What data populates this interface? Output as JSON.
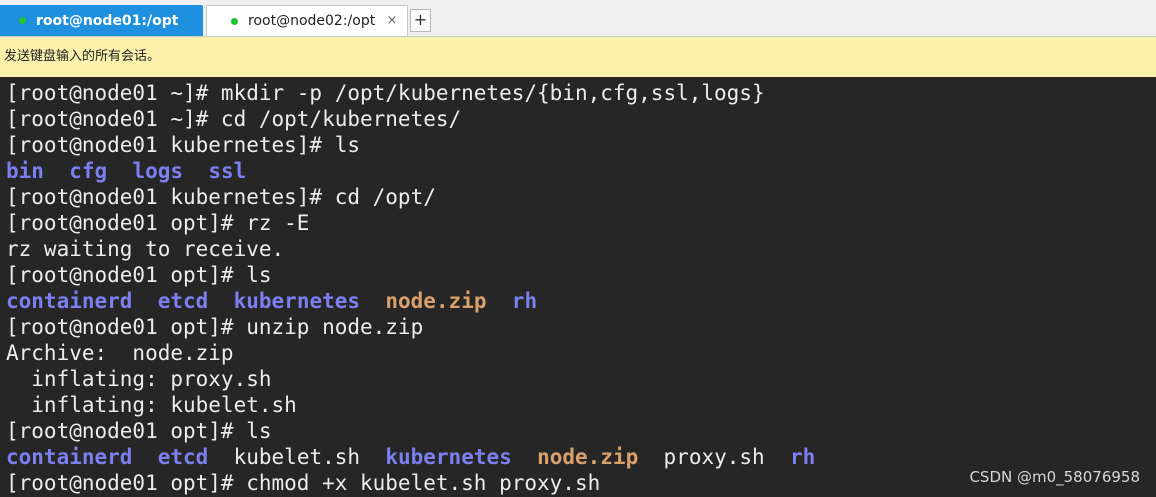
{
  "tabs": [
    {
      "label": "root@node01:/opt",
      "active": true
    },
    {
      "label": "root@node02:/opt",
      "active": false
    }
  ],
  "tab_close_glyph": "×",
  "add_tab_glyph": "+",
  "notice_text": "发送键盘输入的所有会话。",
  "colors": {
    "tab_active_bg": "#1f8fe0",
    "status_dot": "#1ec431",
    "notice_bg": "#fbf1ad",
    "terminal_bg": "#262626",
    "dir_color": "#7b7ff0",
    "zip_color": "#d9a06b"
  },
  "terminal": {
    "lines": [
      [
        {
          "t": "[root@node01 ~]# mkdir -p /opt/kubernetes/{bin,cfg,ssl,logs}",
          "k": "plain"
        }
      ],
      [
        {
          "t": "[root@node01 ~]# cd /opt/kubernetes/",
          "k": "plain"
        }
      ],
      [
        {
          "t": "[root@node01 kubernetes]# ls",
          "k": "plain"
        }
      ],
      [
        {
          "t": "bin",
          "k": "dir"
        },
        {
          "t": "  ",
          "k": "plain"
        },
        {
          "t": "cfg",
          "k": "dir"
        },
        {
          "t": "  ",
          "k": "plain"
        },
        {
          "t": "logs",
          "k": "dir"
        },
        {
          "t": "  ",
          "k": "plain"
        },
        {
          "t": "ssl",
          "k": "dir"
        }
      ],
      [
        {
          "t": "[root@node01 kubernetes]# cd /opt/",
          "k": "plain"
        }
      ],
      [
        {
          "t": "[root@node01 opt]# rz -E",
          "k": "plain"
        }
      ],
      [
        {
          "t": "rz waiting to receive.",
          "k": "plain"
        }
      ],
      [
        {
          "t": "[root@node01 opt]# ls",
          "k": "plain"
        }
      ],
      [
        {
          "t": "containerd",
          "k": "dir"
        },
        {
          "t": "  ",
          "k": "plain"
        },
        {
          "t": "etcd",
          "k": "dir"
        },
        {
          "t": "  ",
          "k": "plain"
        },
        {
          "t": "kubernetes",
          "k": "dir"
        },
        {
          "t": "  ",
          "k": "plain"
        },
        {
          "t": "node.zip",
          "k": "zip"
        },
        {
          "t": "  ",
          "k": "plain"
        },
        {
          "t": "rh",
          "k": "dir"
        }
      ],
      [
        {
          "t": "[root@node01 opt]# unzip node.zip",
          "k": "plain"
        }
      ],
      [
        {
          "t": "Archive:  node.zip",
          "k": "plain"
        }
      ],
      [
        {
          "t": "  inflating: proxy.sh",
          "k": "plain"
        }
      ],
      [
        {
          "t": "  inflating: kubelet.sh",
          "k": "plain"
        }
      ],
      [
        {
          "t": "[root@node01 opt]# ls",
          "k": "plain"
        }
      ],
      [
        {
          "t": "containerd",
          "k": "dir"
        },
        {
          "t": "  ",
          "k": "plain"
        },
        {
          "t": "etcd",
          "k": "dir"
        },
        {
          "t": "  ",
          "k": "plain"
        },
        {
          "t": "kubelet.sh",
          "k": "plain"
        },
        {
          "t": "  ",
          "k": "plain"
        },
        {
          "t": "kubernetes",
          "k": "dir"
        },
        {
          "t": "  ",
          "k": "plain"
        },
        {
          "t": "node.zip",
          "k": "zip"
        },
        {
          "t": "  ",
          "k": "plain"
        },
        {
          "t": "proxy.sh",
          "k": "plain"
        },
        {
          "t": "  ",
          "k": "plain"
        },
        {
          "t": "rh",
          "k": "dir"
        }
      ],
      [
        {
          "t": "[root@node01 opt]# chmod +x kubelet.sh proxy.sh",
          "k": "plain"
        }
      ]
    ]
  },
  "watermark": "CSDN @m0_58076958"
}
